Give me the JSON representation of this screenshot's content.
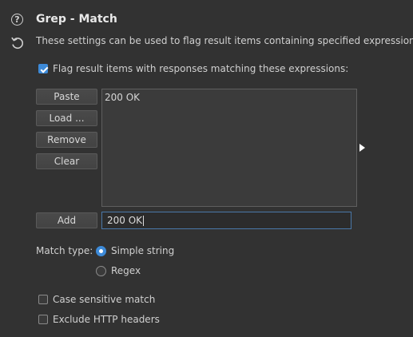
{
  "header": {
    "title": "Grep - Match",
    "description": "These settings can be used to flag result items containing specified expressions.",
    "help_icon": "help-icon",
    "reset_icon": "reset-icon"
  },
  "flag_checkbox": {
    "label": "Flag result items with responses matching these expressions:",
    "checked": true
  },
  "buttons": {
    "paste": "Paste",
    "load": "Load ...",
    "remove": "Remove",
    "clear": "Clear",
    "add": "Add"
  },
  "expressions": [
    "200 OK"
  ],
  "add_input": {
    "value": "200 OK"
  },
  "match_type": {
    "label": "Match type:",
    "options": [
      {
        "label": "Simple string",
        "selected": true
      },
      {
        "label": "Regex",
        "selected": false
      }
    ]
  },
  "options": {
    "case_sensitive": {
      "label": "Case sensitive match",
      "checked": false
    },
    "exclude_headers": {
      "label": "Exclude HTTP headers",
      "checked": false
    }
  },
  "colors": {
    "background": "#323232",
    "accent": "#3d8ad8"
  }
}
